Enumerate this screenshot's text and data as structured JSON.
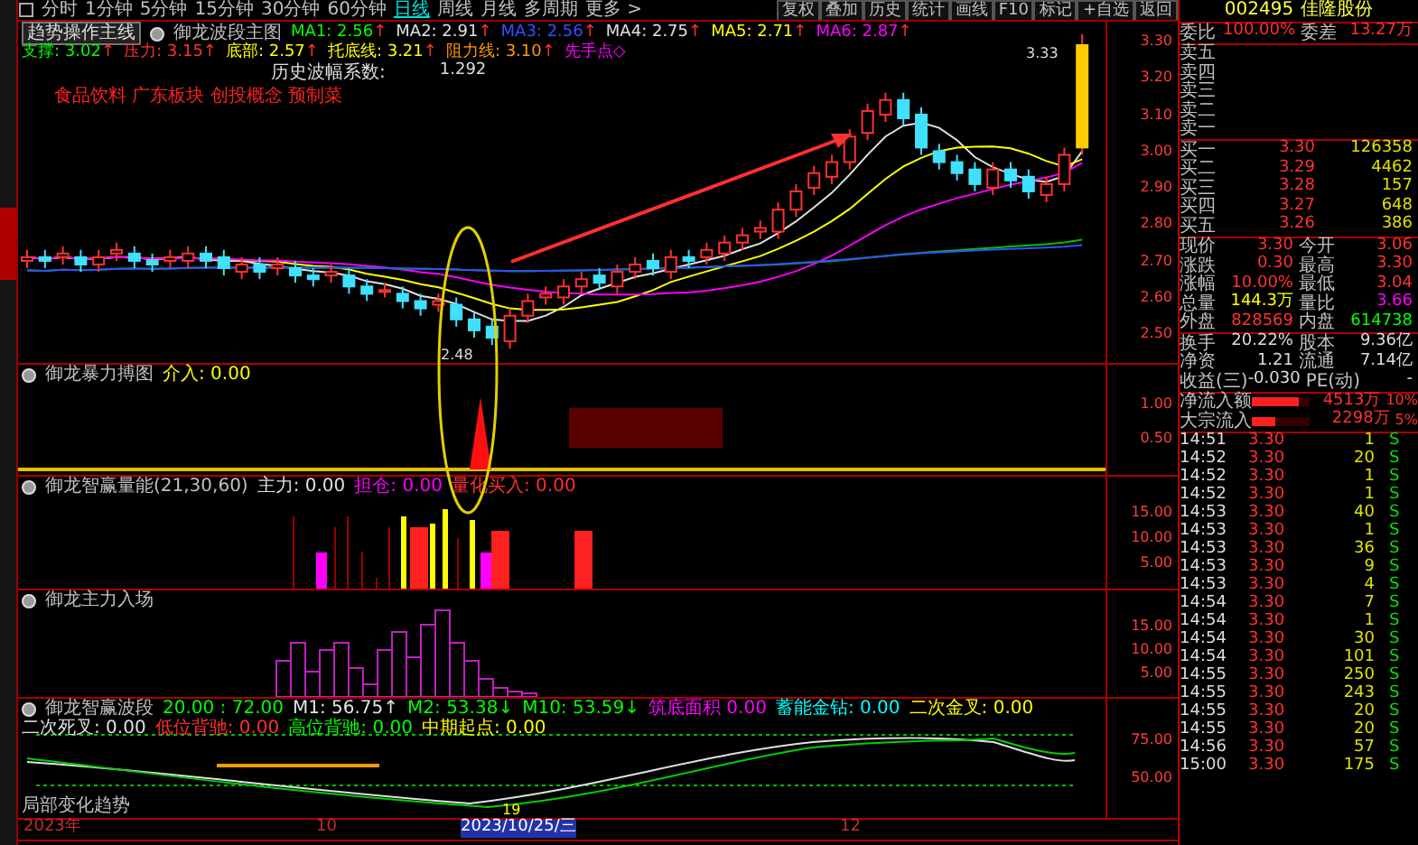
{
  "toolbar": {
    "periods": [
      {
        "label": "分时",
        "selected": false
      },
      {
        "label": "1分钟",
        "selected": false
      },
      {
        "label": "5分钟",
        "selected": false
      },
      {
        "label": "15分钟",
        "selected": false
      },
      {
        "label": "30分钟",
        "selected": false
      },
      {
        "label": "60分钟",
        "selected": false
      },
      {
        "label": "日线",
        "selected": true
      },
      {
        "label": "周线",
        "selected": false
      },
      {
        "label": "月线",
        "selected": false
      },
      {
        "label": "多周期",
        "selected": false
      },
      {
        "label": "更多 >",
        "selected": false
      }
    ],
    "tools": [
      "复权",
      "叠加",
      "历史",
      "统计",
      "画线",
      "F10",
      "标记",
      "+自选",
      "返回"
    ]
  },
  "main_chart": {
    "template_button": "趋势操作主线",
    "indicator_name": "御龙波段主图",
    "ma_legend": [
      {
        "text": "MA1: 2.56",
        "color": "#00ff00",
        "arrow": "↑"
      },
      {
        "text": "MA2: 2.91",
        "color": "#e0e0e0",
        "arrow": "↑"
      },
      {
        "text": "MA3: 2.56",
        "color": "#3050ff",
        "arrow": "↑"
      },
      {
        "text": "MA4: 2.75",
        "color": "#e0e0e0",
        "arrow": "↑"
      },
      {
        "text": "MA5: 2.71",
        "color": "#ffff00",
        "arrow": "↑"
      },
      {
        "text": "MA6: 2.87",
        "color": "#ff00ff",
        "arrow": "↑"
      }
    ],
    "level_legend": [
      {
        "text": "支撑: 3.02",
        "color": "#00ff00",
        "arrow": "↑"
      },
      {
        "text": "压力: 3.15",
        "color": "#ff3030",
        "arrow": "↑"
      },
      {
        "text": "底部: 2.57",
        "color": "#ffff00",
        "arrow": "↑"
      },
      {
        "text": "托底线: 3.21",
        "color": "#ffff00",
        "arrow": "↑"
      },
      {
        "text": "阻力线: 3.10",
        "color": "#ff9900",
        "arrow": "↑"
      },
      {
        "text": "先手点◇",
        "color": "#ff00ff"
      }
    ],
    "coefficient_label": "历史波幅系数:",
    "coefficient_value": "1.292",
    "sectors": "食品饮料 广东板块 创投概念 预制菜",
    "price_axis": [
      "3.30",
      "3.20",
      "3.10",
      "3.00",
      "2.90",
      "2.80",
      "2.70",
      "2.60",
      "2.50"
    ],
    "high_label": "3.33",
    "low_label": "2.48"
  },
  "panes": [
    {
      "title": "御龙暴力搏图",
      "kind": "signal",
      "legend": [
        {
          "text": "介入: 0.00",
          "color": "#ffff00"
        }
      ],
      "axis": [
        "1.00",
        "0.50"
      ]
    },
    {
      "title": "御龙智赢量能(21,30,60)",
      "kind": "volume",
      "legend": [
        {
          "text": "主力: 0.00",
          "color": "#e0e0e0"
        },
        {
          "text": "担仓: 0.00",
          "color": "#ff00ff"
        },
        {
          "text": "量化买入: 0.00",
          "color": "#ff3030"
        }
      ],
      "axis": [
        "15.00",
        "10.00",
        "5.00"
      ]
    },
    {
      "title": "御龙主力入场",
      "kind": "histogram",
      "axis": [
        "15.00",
        "10.00",
        "5.00"
      ]
    },
    {
      "title": "御龙智赢波段",
      "kind": "wave",
      "legend": [
        {
          "text": "20.00 : 72.00",
          "color": "#00ff00"
        },
        {
          "text": "M1: 56.75↑",
          "color": "#e0e0e0"
        },
        {
          "text": "M2: 53.38↓",
          "color": "#00ff00"
        },
        {
          "text": "M10: 53.59↓",
          "color": "#00ff00"
        },
        {
          "text": "筑底面积 0.00",
          "color": "#ff00ff"
        },
        {
          "text": "蓄能金钻: 0.00",
          "color": "#00ffff"
        },
        {
          "text": "二次金叉: 0.00",
          "color": "#ffff00"
        },
        {
          "text": "二次死叉: 0.00",
          "color": "#e0e0e0"
        },
        {
          "text": "低位背驰: 0.00",
          "color": "#ff3030"
        },
        {
          "text": "高位背驰: 0.00",
          "color": "#00ff00"
        },
        {
          "text": "中期起点: 0.00",
          "color": "#ffff00"
        }
      ],
      "axis": [
        "75.00",
        "50.00"
      ],
      "footnote": "局部变化趋势",
      "marker": "19"
    }
  ],
  "date_axis": [
    {
      "text": "2023年",
      "selected": false
    },
    {
      "text": "10",
      "selected": false
    },
    {
      "text": "2023/10/25/三",
      "selected": true
    },
    {
      "text": "12",
      "selected": false
    }
  ],
  "quote": {
    "code": "002495",
    "name": "佳隆股份",
    "ratio": [
      {
        "label": "委比",
        "value": "100.00%",
        "color": "#ff3030"
      },
      {
        "label": "委差",
        "value": "13.27万",
        "color": "#ff3030"
      }
    ],
    "asks": [
      {
        "label": "卖五"
      },
      {
        "label": "卖四"
      },
      {
        "label": "卖三"
      },
      {
        "label": "卖二"
      },
      {
        "label": "卖一"
      }
    ],
    "bids": [
      {
        "label": "买一",
        "price": "3.30",
        "volume": "126358"
      },
      {
        "label": "买二",
        "price": "3.29",
        "volume": "4462"
      },
      {
        "label": "买三",
        "price": "3.28",
        "volume": "157"
      },
      {
        "label": "买四",
        "price": "3.27",
        "volume": "648"
      },
      {
        "label": "买五",
        "price": "3.26",
        "volume": "386"
      }
    ],
    "stats": [
      [
        {
          "label": "现价",
          "value": "3.30",
          "color": "#ff3030"
        },
        {
          "label": "今开",
          "value": "3.06",
          "color": "#ff3030"
        }
      ],
      [
        {
          "label": "涨跌",
          "value": "0.30",
          "color": "#ff3030"
        },
        {
          "label": "最高",
          "value": "3.30",
          "color": "#ff3030"
        }
      ],
      [
        {
          "label": "涨幅",
          "value": "10.00%",
          "color": "#ff3030"
        },
        {
          "label": "最低",
          "value": "3.04",
          "color": "#ff3030"
        }
      ],
      [
        {
          "label": "总量",
          "value": "144.3万",
          "color": "#ffff00"
        },
        {
          "label": "量比",
          "value": "3.66",
          "color": "#ff00ff"
        }
      ],
      [
        {
          "label": "外盘",
          "value": "828569",
          "color": "#ff3030"
        },
        {
          "label": "内盘",
          "value": "614738",
          "color": "#00ff00"
        }
      ]
    ],
    "fundamentals": [
      [
        {
          "label": "换手",
          "value": "20.22%"
        },
        {
          "label": "股本",
          "value": "9.36亿"
        }
      ],
      [
        {
          "label": "净资",
          "value": "1.21"
        },
        {
          "label": "流通",
          "value": "7.14亿"
        }
      ],
      [
        {
          "label": "收益(三)",
          "value": "-0.030"
        },
        {
          "label": "PE(动)",
          "value": "-"
        }
      ]
    ],
    "flows": [
      {
        "label": "净流入额",
        "level": 0.8,
        "value": "4513万",
        "share": "10%"
      },
      {
        "label": "大宗流入",
        "level": 0.4,
        "value": "2298万",
        "share": "5%"
      }
    ],
    "ticks": [
      {
        "time": "14:51",
        "price": "3.30",
        "volume": "1",
        "flag": "S",
        "kind": "sell"
      },
      {
        "time": "14:52",
        "price": "3.30",
        "volume": "20",
        "flag": "S",
        "kind": "sell"
      },
      {
        "time": "14:52",
        "price": "3.30",
        "volume": "1",
        "flag": "S",
        "kind": "sell"
      },
      {
        "time": "14:52",
        "price": "3.30",
        "volume": "1",
        "flag": "S",
        "kind": "sell"
      },
      {
        "time": "14:53",
        "price": "3.30",
        "volume": "40",
        "flag": "S",
        "kind": "sell"
      },
      {
        "time": "14:53",
        "price": "3.30",
        "volume": "1",
        "flag": "S",
        "kind": "sell"
      },
      {
        "time": "14:53",
        "price": "3.30",
        "volume": "36",
        "flag": "S",
        "kind": "sell"
      },
      {
        "time": "14:53",
        "price": "3.30",
        "volume": "9",
        "flag": "S",
        "kind": "sell"
      },
      {
        "time": "14:53",
        "price": "3.30",
        "volume": "4",
        "flag": "S",
        "kind": "sell"
      },
      {
        "time": "14:54",
        "price": "3.30",
        "volume": "7",
        "flag": "S",
        "kind": "sell"
      },
      {
        "time": "14:54",
        "price": "3.30",
        "volume": "1",
        "flag": "S",
        "kind": "sell"
      },
      {
        "time": "14:54",
        "price": "3.30",
        "volume": "30",
        "flag": "S",
        "kind": "sell"
      },
      {
        "time": "14:54",
        "price": "3.30",
        "volume": "101",
        "flag": "S",
        "kind": "sell"
      },
      {
        "time": "14:55",
        "price": "3.30",
        "volume": "250",
        "flag": "S",
        "kind": "sell"
      },
      {
        "time": "14:55",
        "price": "3.30",
        "volume": "243",
        "flag": "S",
        "kind": "sell"
      },
      {
        "time": "14:55",
        "price": "3.30",
        "volume": "20",
        "flag": "S",
        "kind": "sell"
      },
      {
        "time": "14:55",
        "price": "3.30",
        "volume": "20",
        "flag": "S",
        "kind": "sell"
      },
      {
        "time": "14:56",
        "price": "3.30",
        "volume": "57",
        "flag": "S",
        "kind": "sell"
      },
      {
        "time": "15:00",
        "price": "3.30",
        "volume": "175",
        "flag": "S",
        "kind": "sell"
      }
    ]
  }
}
